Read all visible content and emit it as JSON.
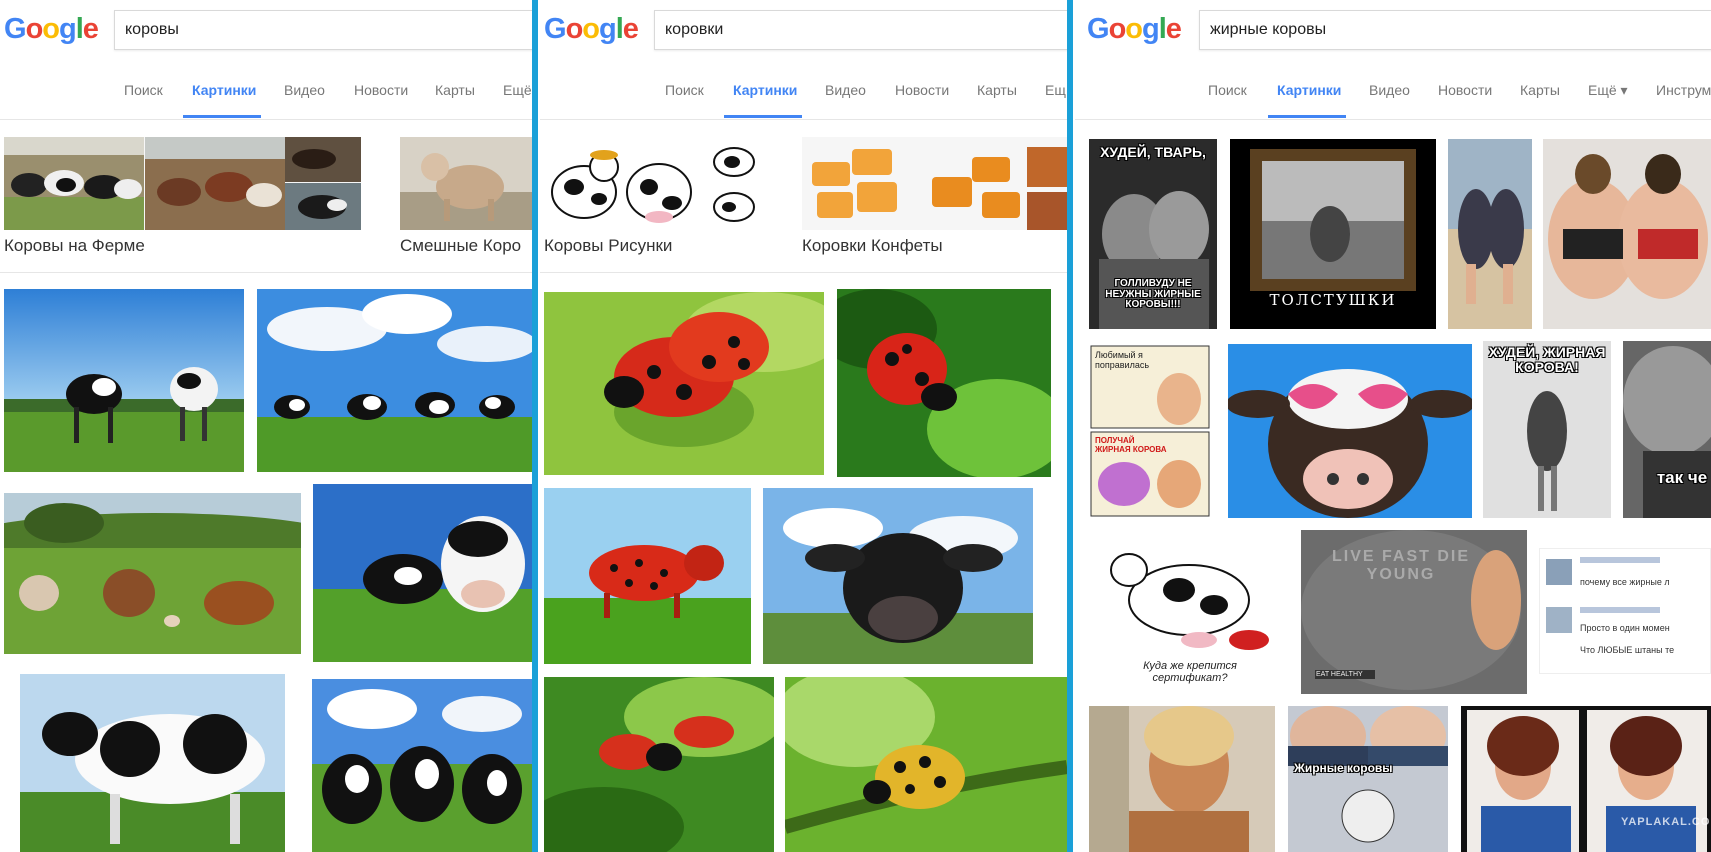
{
  "panels": [
    {
      "search_value": "коровы",
      "tabs": [
        "Поиск",
        "Картинки",
        "Видео",
        "Новости",
        "Карты",
        "Ещё"
      ],
      "active_tab": "Картинки",
      "suggestions": [
        "Коровы на Ферме",
        "Смешные Коро"
      ]
    },
    {
      "search_value": "коровки",
      "tabs": [
        "Поиск",
        "Картинки",
        "Видео",
        "Новости",
        "Карты",
        "Ещ"
      ],
      "active_tab": "Картинки",
      "suggestions": [
        "Коровы Рисунки",
        "Коровки Конфеты"
      ]
    },
    {
      "search_value": "жирные коровы",
      "tabs": [
        "Поиск",
        "Картинки",
        "Видео",
        "Новости",
        "Карты",
        "Ещё ▾",
        "Инструме"
      ],
      "active_tab": "Картинки",
      "image_captions": {
        "meme1_top": "ХУДЕЙ, ТВАРЬ,",
        "meme1_bottom": "ГОЛЛИВУДУ НЕ НЕУЖНЫ ЖИРНЫЕ КОРОВЫ!!!",
        "frame_caption": "ТОЛСТУШКИ",
        "comic_top": "Любимый я поправилась",
        "comic_bottom": "ПОЛУЧАЙ ЖИРНАЯ КОРОВА",
        "meme2_top": "ХУДЕЙ, ЖИРНАЯ КОРОВА!",
        "partial_meme": "так чe",
        "cartoon_caption": "Куда же крепится сертификат?",
        "shirt_text": "LIVE FAST DIE YOUNG",
        "shirt_label": "EAT HEALTHY",
        "belly_caption": "Жирные коровы",
        "watermark": "YAPLAKAL.COM"
      },
      "comments": [
        "почему все жирные л",
        "Просто в один момен",
        "Что ЛЮБЫЕ штаны те"
      ]
    }
  ],
  "logo_text": "Google",
  "colors": {
    "divider": "#1aa0d8",
    "accent": "#4285f4"
  }
}
